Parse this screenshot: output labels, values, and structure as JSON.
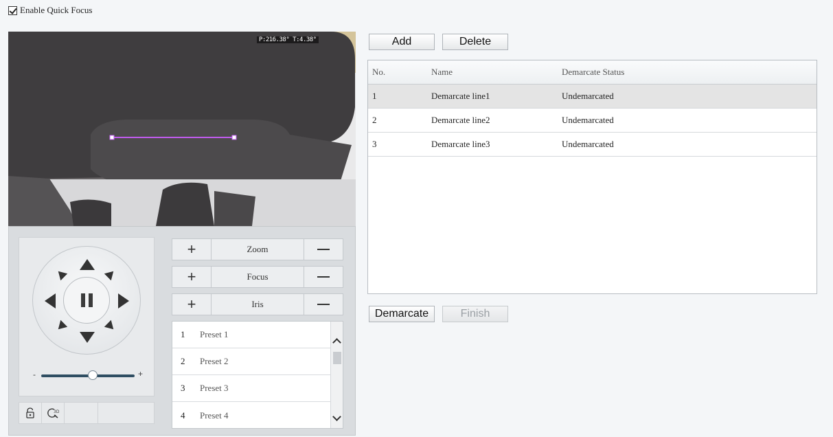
{
  "quick_focus": {
    "label": "Enable Quick Focus",
    "checked": true
  },
  "video": {
    "osd_text": "P:216.38° T:4.38°",
    "line_color": "#c15cf0"
  },
  "ptz": {
    "speed_min_label": "-",
    "speed_max_label": "+",
    "speed_level": 0.55,
    "lens": [
      {
        "label": "Zoom"
      },
      {
        "label": "Focus"
      },
      {
        "label": "Iris"
      }
    ],
    "presets": [
      {
        "no": "1",
        "name": "Preset 1"
      },
      {
        "no": "2",
        "name": "Preset 2"
      },
      {
        "no": "3",
        "name": "Preset 3"
      },
      {
        "no": "4",
        "name": "Preset 4"
      }
    ],
    "tools": [
      "lock-icon",
      "3d-positioning-icon",
      "blank",
      "blank"
    ]
  },
  "toolbar": {
    "add_label": "Add",
    "delete_label": "Delete"
  },
  "table": {
    "columns": [
      "No.",
      "Name",
      "Demarcate Status"
    ],
    "rows": [
      {
        "no": "1",
        "name": "Demarcate line1",
        "status": "Undemarcated",
        "selected": true
      },
      {
        "no": "2",
        "name": "Demarcate line2",
        "status": "Undemarcated",
        "selected": false
      },
      {
        "no": "3",
        "name": "Demarcate line3",
        "status": "Undemarcated",
        "selected": false
      }
    ]
  },
  "actions": {
    "demarcate_label": "Demarcate",
    "finish_label": "Finish"
  }
}
